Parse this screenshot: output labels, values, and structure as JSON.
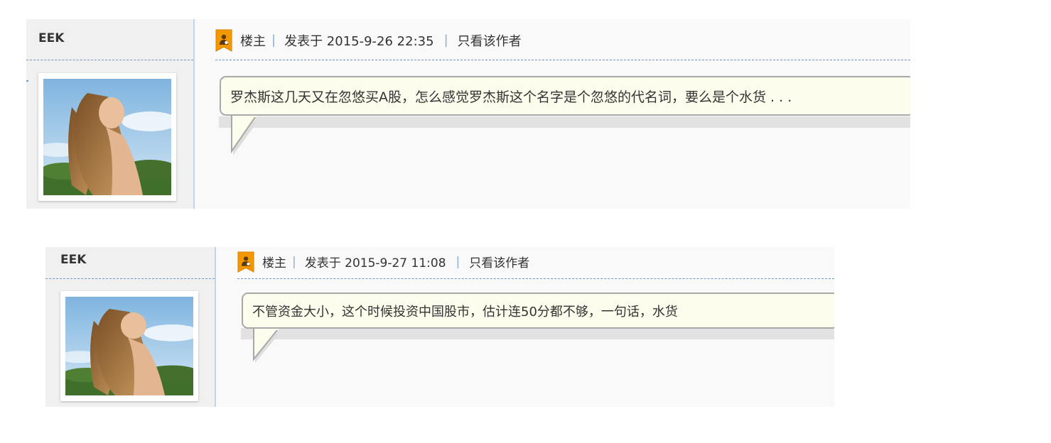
{
  "posts": [
    {
      "author": "EEK",
      "role": "楼主",
      "posted": "发表于 2015-9-26 22:35",
      "only_author": "只看该作者",
      "message": "罗杰斯这几天又在忽悠买A股，怎么感觉罗杰斯这个名字是个忽悠的代名词，要么是个水货 . . ."
    },
    {
      "author": "EEK",
      "role": "楼主",
      "posted": "发表于 2015-9-27 11:08",
      "only_author": "只看该作者",
      "message": "不管资金大小，这个时候投资中国股市，估计连50分都不够，一句话，水货"
    }
  ],
  "icons": {
    "owner": "thread-starter-icon",
    "avatar": "avatar"
  },
  "colors": {
    "accent": "#6f96c8",
    "owner_icon": "#f39800",
    "bubble": "#fdfdee"
  }
}
